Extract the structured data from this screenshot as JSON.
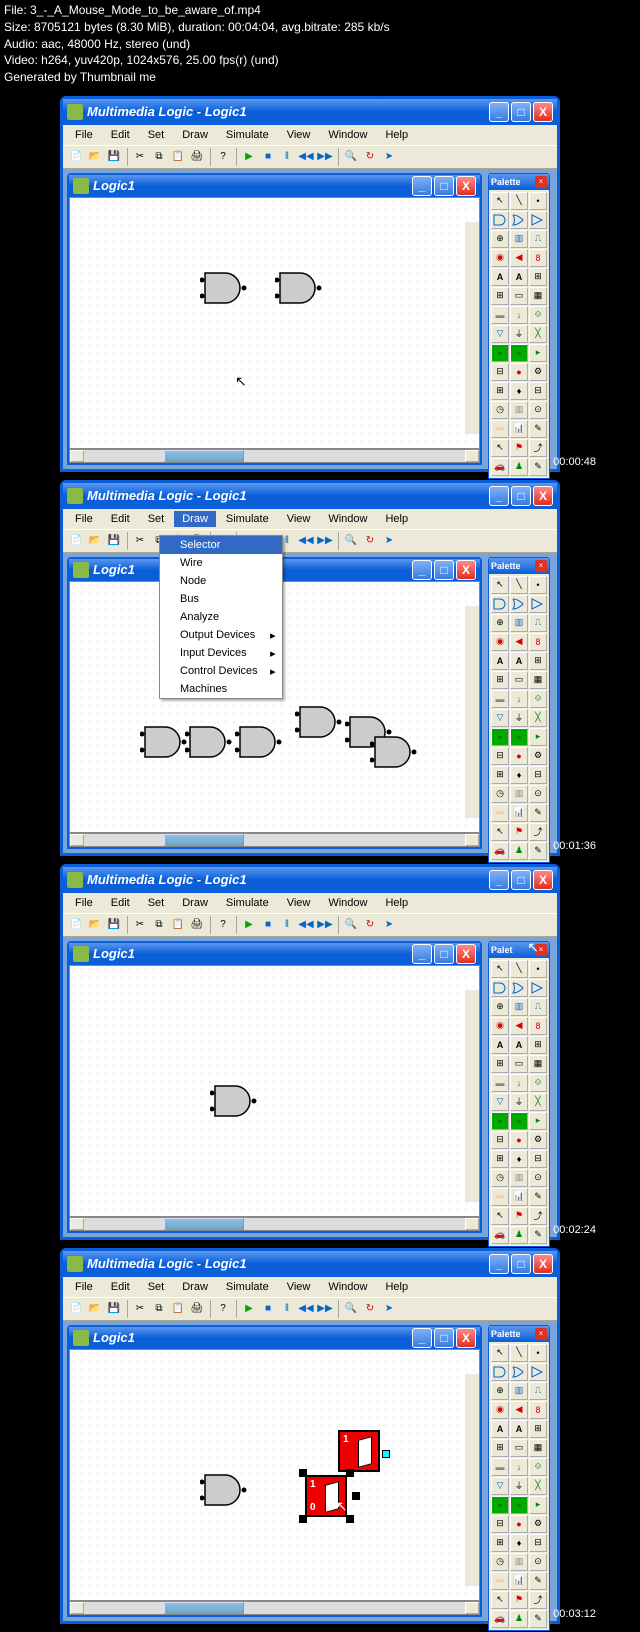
{
  "meta": {
    "line1": "File: 3_-_A_Mouse_Mode_to_be_aware_of.mp4",
    "line2": "Size: 8705121 bytes (8.30 MiB), duration: 00:04:04, avg.bitrate: 285 kb/s",
    "line3": "Audio: aac, 48000 Hz, stereo (und)",
    "line4": "Video: h264, yuv420p, 1024x576, 25.00 fps(r) (und)",
    "line5": "Generated by Thumbnail me"
  },
  "app": {
    "title": "Multimedia Logic - Logic1",
    "doc_title": "Logic1"
  },
  "menu": {
    "file": "File",
    "edit": "Edit",
    "set": "Set",
    "draw": "Draw",
    "simulate": "Simulate",
    "view": "View",
    "window": "Window",
    "help": "Help"
  },
  "palette": {
    "title": "Palette"
  },
  "draw_menu": {
    "selector": "Selector",
    "wire": "Wire",
    "node": "Node",
    "bus": "Bus",
    "analyze": "Analyze",
    "output": "Output Devices",
    "input": "Input Devices",
    "control": "Control Devices",
    "machines": "Machines"
  },
  "timestamps": {
    "t1": "00:00:48",
    "t2": "00:01:36",
    "t3": "00:02:24",
    "t4": "00:03:12"
  },
  "switch": {
    "one": "1",
    "zero": "0"
  }
}
